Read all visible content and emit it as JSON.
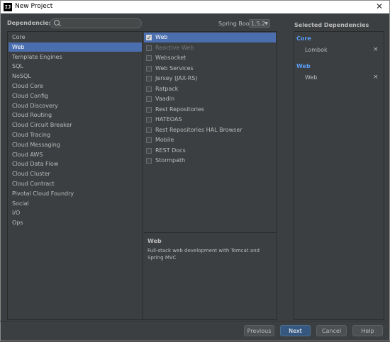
{
  "window": {
    "title": "New Project",
    "icon": "IJ"
  },
  "header": {
    "dependencies_label": "Dependencies",
    "search_placeholder": "",
    "spring_boot_label": "Spring Boot",
    "spring_boot_version": "1.5.2",
    "selected_dependencies_title": "Selected Dependencies"
  },
  "categories": [
    {
      "label": "Core",
      "selected": false
    },
    {
      "label": "Web",
      "selected": true
    },
    {
      "label": "Template Engines",
      "selected": false
    },
    {
      "label": "SQL",
      "selected": false
    },
    {
      "label": "NoSQL",
      "selected": false
    },
    {
      "label": "Cloud Core",
      "selected": false
    },
    {
      "label": "Cloud Config",
      "selected": false
    },
    {
      "label": "Cloud Discovery",
      "selected": false
    },
    {
      "label": "Cloud Routing",
      "selected": false
    },
    {
      "label": "Cloud Circuit Breaker",
      "selected": false
    },
    {
      "label": "Cloud Tracing",
      "selected": false
    },
    {
      "label": "Cloud Messaging",
      "selected": false
    },
    {
      "label": "Cloud AWS",
      "selected": false
    },
    {
      "label": "Cloud Data Flow",
      "selected": false
    },
    {
      "label": "Cloud Cluster",
      "selected": false
    },
    {
      "label": "Cloud Contract",
      "selected": false
    },
    {
      "label": "Pivotal Cloud Foundry",
      "selected": false
    },
    {
      "label": "Social",
      "selected": false
    },
    {
      "label": "I/O",
      "selected": false
    },
    {
      "label": "Ops",
      "selected": false
    }
  ],
  "dependencies": [
    {
      "label": "Web",
      "checked": true,
      "selected": true,
      "disabled": false
    },
    {
      "label": "Reactive Web",
      "checked": false,
      "selected": false,
      "disabled": true
    },
    {
      "label": "Websocket",
      "checked": false,
      "selected": false,
      "disabled": false
    },
    {
      "label": "Web Services",
      "checked": false,
      "selected": false,
      "disabled": false
    },
    {
      "label": "Jersey (JAX-RS)",
      "checked": false,
      "selected": false,
      "disabled": false
    },
    {
      "label": "Ratpack",
      "checked": false,
      "selected": false,
      "disabled": false
    },
    {
      "label": "Vaadin",
      "checked": false,
      "selected": false,
      "disabled": false
    },
    {
      "label": "Rest Repositories",
      "checked": false,
      "selected": false,
      "disabled": false
    },
    {
      "label": "HATEOAS",
      "checked": false,
      "selected": false,
      "disabled": false
    },
    {
      "label": "Rest Repositories HAL Browser",
      "checked": false,
      "selected": false,
      "disabled": false
    },
    {
      "label": "Mobile",
      "checked": false,
      "selected": false,
      "disabled": false
    },
    {
      "label": "REST Docs",
      "checked": false,
      "selected": false,
      "disabled": false
    },
    {
      "label": "Stormpath",
      "checked": false,
      "selected": false,
      "disabled": false
    }
  ],
  "description": {
    "title": "Web",
    "text": "Full-stack web development with Tomcat and Spring MVC"
  },
  "selected_groups": [
    {
      "group": "Core",
      "items": [
        "Lombok"
      ]
    },
    {
      "group": "Web",
      "items": [
        "Web"
      ]
    }
  ],
  "remove_glyph": "×",
  "buttons": {
    "previous": "Previous",
    "next": "Next",
    "cancel": "Cancel",
    "help": "Help"
  },
  "colors": {
    "background": "#3c3f41",
    "selection": "#4b6eaf",
    "group_title": "#589df6",
    "primary_button": "#365880"
  }
}
